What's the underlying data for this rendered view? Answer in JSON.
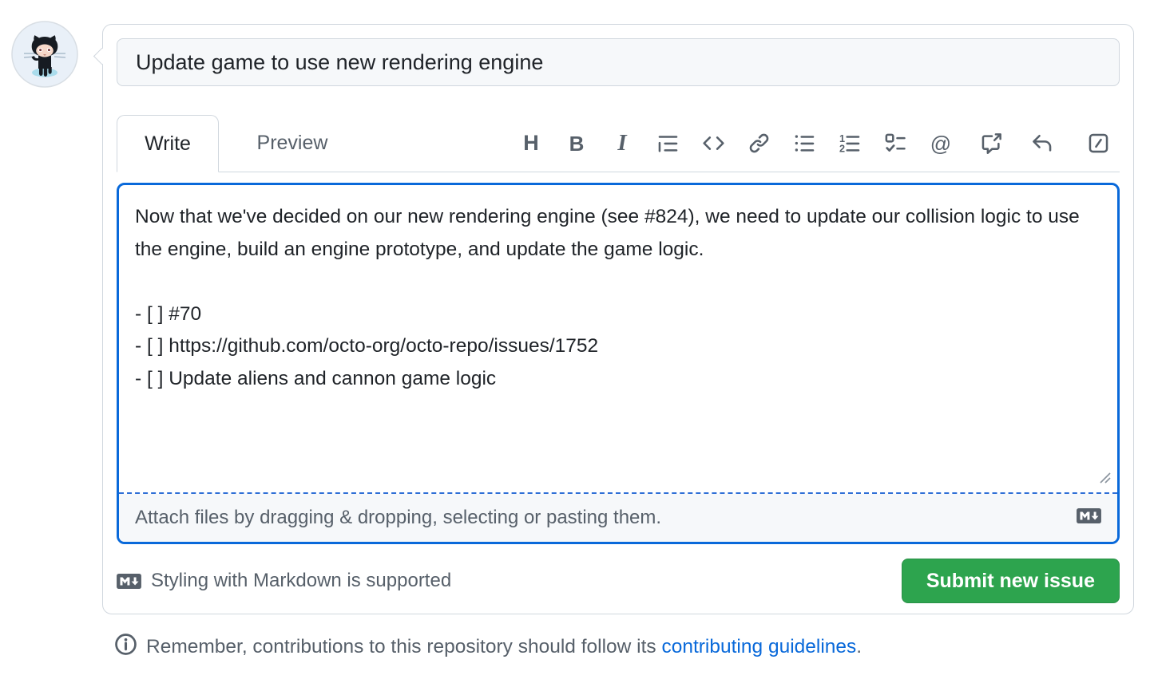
{
  "user": {
    "avatar_alt": "octocat avatar"
  },
  "issue_form": {
    "title": {
      "value": "Update game to use new rendering engine"
    },
    "tabs": [
      {
        "label": "Write",
        "active": true
      },
      {
        "label": "Preview",
        "active": false
      }
    ],
    "toolbar": {
      "items": [
        {
          "name": "heading",
          "glyph": "H"
        },
        {
          "name": "bold",
          "glyph": "B"
        },
        {
          "name": "italic",
          "glyph": "I"
        },
        {
          "name": "quote"
        },
        {
          "name": "code"
        },
        {
          "name": "link"
        },
        {
          "name": "unordered-list"
        },
        {
          "name": "ordered-list"
        },
        {
          "name": "task-list"
        },
        {
          "name": "mention",
          "glyph": "@"
        },
        {
          "name": "cross-reference"
        },
        {
          "name": "saved-replies"
        },
        {
          "name": "slash-commands"
        }
      ]
    },
    "body": {
      "value": "Now that we've decided on our new rendering engine (see #824), we need to update our collision logic to use the engine, build an engine prototype, and update the game logic.\n\n- [ ] #70\n- [ ] https://github.com/octo-org/octo-repo/issues/1752\n- [ ] Update aliens and cannon game logic"
    },
    "attach_hint": "Attach files by dragging & dropping, selecting or pasting them.",
    "markdown_support_note": "Styling with Markdown is supported",
    "submit_button_label": "Submit new issue"
  },
  "footer": {
    "reminder_prefix": "Remember, contributions to this repository should follow its ",
    "link_text": "contributing guidelines",
    "suffix": "."
  },
  "colors": {
    "accent_blue": "#0969da",
    "success_green": "#2da44e",
    "border_gray": "#d0d7de",
    "muted_text": "#57606a",
    "body_text": "#1f2328"
  }
}
